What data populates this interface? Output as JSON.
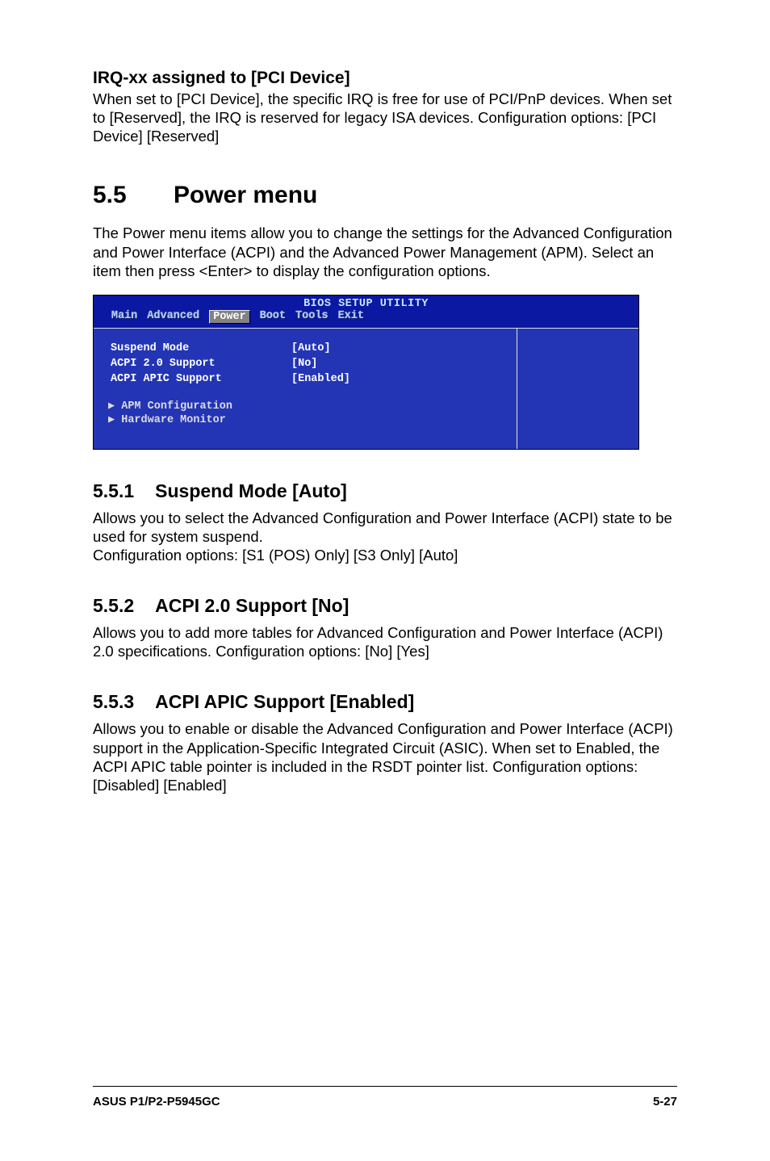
{
  "section_irq": {
    "heading": "IRQ-xx assigned to [PCI Device]",
    "body": "When set to [PCI Device], the specific IRQ is free for use of PCI/PnP devices. When set to [Reserved], the IRQ is reserved for legacy ISA devices. Configuration options: [PCI Device] [Reserved]"
  },
  "power_menu": {
    "number": "5.5",
    "title": "Power menu",
    "intro": "The Power menu items allow you to change the settings for the Advanced Configuration and Power Interface (ACPI) and the Advanced Power Management (APM). Select an item then press <Enter> to display the configuration options."
  },
  "bios": {
    "title": "BIOS SETUP UTILITY",
    "tabs": {
      "main": "Main",
      "advanced": "Advanced",
      "power": "Power",
      "boot": "Boot",
      "tools": "Tools",
      "exit": "Exit"
    },
    "items": [
      {
        "label": "Suspend Mode",
        "value": "[Auto]"
      },
      {
        "label": "ACPI 2.0 Support",
        "value": "[No]"
      },
      {
        "label": "ACPI APIC Support",
        "value": "[Enabled]"
      }
    ],
    "submenus": [
      "APM Configuration",
      "Hardware Monitor"
    ]
  },
  "sub1": {
    "number": "5.5.1",
    "title": "Suspend Mode [Auto]",
    "body1": "Allows you to select the Advanced Configuration and Power Interface (ACPI) state to be used for system suspend.",
    "body2": "Configuration options: [S1 (POS) Only] [S3 Only] [Auto]"
  },
  "sub2": {
    "number": "5.5.2",
    "title": "ACPI 2.0 Support [No]",
    "body": "Allows you to add more tables for Advanced Configuration and Power Interface (ACPI) 2.0 specifications. Configuration options: [No] [Yes]"
  },
  "sub3": {
    "number": "5.5.3",
    "title": "ACPI APIC Support [Enabled]",
    "body": "Allows you to enable or disable the Advanced Configuration and Power Interface (ACPI) support in the Application-Specific Integrated Circuit (ASIC). When set to Enabled, the ACPI APIC table pointer is included in the RSDT pointer list. Configuration options: [Disabled] [Enabled]"
  },
  "footer": {
    "product": "ASUS P1/P2-P5945GC",
    "page": "5-27"
  }
}
